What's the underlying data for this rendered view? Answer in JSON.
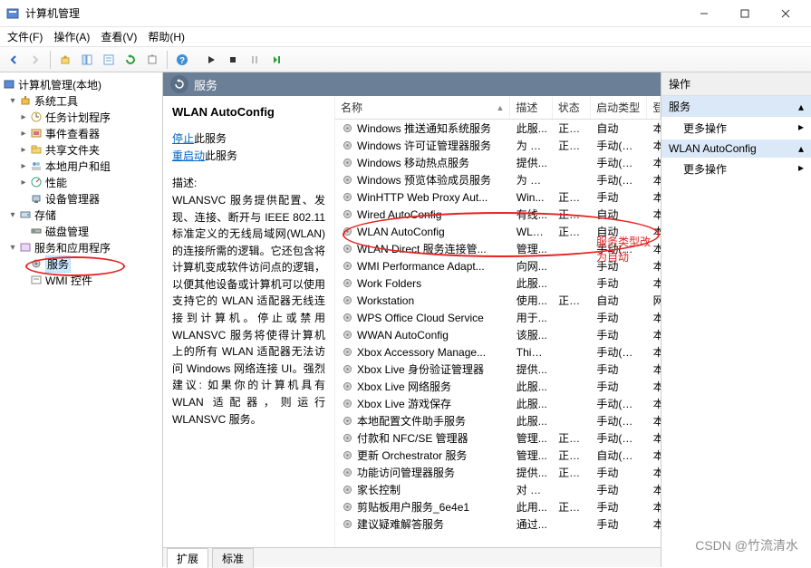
{
  "window": {
    "title": "计算机管理"
  },
  "menubar": [
    "文件(F)",
    "操作(A)",
    "查看(V)",
    "帮助(H)"
  ],
  "tree": {
    "root": "计算机管理(本地)",
    "system_tools": "系统工具",
    "task_scheduler": "任务计划程序",
    "event_viewer": "事件查看器",
    "shared_folders": "共享文件夹",
    "local_users": "本地用户和组",
    "performance": "性能",
    "device_manager": "设备管理器",
    "storage": "存储",
    "disk_management": "磁盘管理",
    "services_apps": "服务和应用程序",
    "services": "服务",
    "wmi": "WMI 控件"
  },
  "center": {
    "header": "服务",
    "selected": "WLAN AutoConfig",
    "links": {
      "stop": "停止",
      "stop_tail": "此服务",
      "restart": "重启动",
      "restart_tail": "此服务"
    },
    "desc_label": "描述:",
    "desc": "WLANSVC 服务提供配置、发现、连接、断开与 IEEE 802.11 标准定义的无线局域网(WLAN)的连接所需的逻辑。它还包含将计算机变成软件访问点的逻辑，以便其他设备或计算机可以使用支持它的 WLAN 适配器无线连接到计算机。停止或禁用 WLANSVC 服务将使得计算机上的所有 WLAN 适配器无法访问 Windows 网络连接 UI。强烈建议: 如果你的计算机具有 WLAN 适配器，则运行 WLANSVC 服务。"
  },
  "columns": {
    "name": "名称",
    "desc": "描述",
    "status": "状态",
    "startup": "启动类型",
    "logon": "登"
  },
  "services": [
    {
      "n": "Windows 推送通知系统服务",
      "d": "此服...",
      "s": "正在...",
      "t": "自动",
      "l": "本"
    },
    {
      "n": "Windows 许可证管理器服务",
      "d": "为 M...",
      "s": "正在...",
      "t": "手动(触发...",
      "l": "本"
    },
    {
      "n": "Windows 移动热点服务",
      "d": "提供...",
      "s": "",
      "t": "手动(触发...",
      "l": "本"
    },
    {
      "n": "Windows 预览体验成员服务",
      "d": "为 W...",
      "s": "",
      "t": "手动(触发...",
      "l": "本"
    },
    {
      "n": "WinHTTP Web Proxy Aut...",
      "d": "Win...",
      "s": "正在...",
      "t": "手动",
      "l": "本"
    },
    {
      "n": "Wired AutoConfig",
      "d": "有线...",
      "s": "正在...",
      "t": "自动",
      "l": "本"
    },
    {
      "n": "WLAN AutoConfig",
      "d": "WLA...",
      "s": "正在...",
      "t": "自动",
      "l": "本"
    },
    {
      "n": "WLAN Direct 服务连接管...",
      "d": "管理...",
      "s": "",
      "t": "手动(触发...",
      "l": "本"
    },
    {
      "n": "WMI Performance Adapt...",
      "d": "向网...",
      "s": "",
      "t": "手动",
      "l": "本"
    },
    {
      "n": "Work Folders",
      "d": "此服...",
      "s": "",
      "t": "手动",
      "l": "本"
    },
    {
      "n": "Workstation",
      "d": "使用...",
      "s": "正在...",
      "t": "自动",
      "l": "网"
    },
    {
      "n": "WPS Office Cloud Service",
      "d": "用于...",
      "s": "",
      "t": "手动",
      "l": "本"
    },
    {
      "n": "WWAN AutoConfig",
      "d": "该服...",
      "s": "",
      "t": "手动",
      "l": "本"
    },
    {
      "n": "Xbox Accessory Manage...",
      "d": "This ...",
      "s": "",
      "t": "手动(触发...",
      "l": "本"
    },
    {
      "n": "Xbox Live 身份验证管理器",
      "d": "提供...",
      "s": "",
      "t": "手动",
      "l": "本"
    },
    {
      "n": "Xbox Live 网络服务",
      "d": "此服...",
      "s": "",
      "t": "手动",
      "l": "本"
    },
    {
      "n": "Xbox Live 游戏保存",
      "d": "此服...",
      "s": "",
      "t": "手动(触发...",
      "l": "本"
    },
    {
      "n": "本地配置文件助手服务",
      "d": "此服...",
      "s": "",
      "t": "手动(触发...",
      "l": "本"
    },
    {
      "n": "付款和 NFC/SE 管理器",
      "d": "管理...",
      "s": "正在...",
      "t": "手动(触发...",
      "l": "本"
    },
    {
      "n": "更新 Orchestrator 服务",
      "d": "管理...",
      "s": "正在...",
      "t": "自动(延迟...",
      "l": "本"
    },
    {
      "n": "功能访问管理器服务",
      "d": "提供...",
      "s": "正在...",
      "t": "手动",
      "l": "本"
    },
    {
      "n": "家长控制",
      "d": "对 W...",
      "s": "",
      "t": "手动",
      "l": "本"
    },
    {
      "n": "剪贴板用户服务_6e4e1",
      "d": "此用...",
      "s": "正在...",
      "t": "手动",
      "l": "本"
    },
    {
      "n": "建议疑难解答服务",
      "d": "通过...",
      "s": "",
      "t": "手动",
      "l": "本"
    }
  ],
  "tabs": {
    "ext": "扩展",
    "std": "标准"
  },
  "actions": {
    "hdr": "操作",
    "sec1": "服务",
    "more1": "更多操作",
    "sec2": "WLAN AutoConfig",
    "more2": "更多操作"
  },
  "annotation": "服务类型改为自动",
  "watermark": "CSDN @竹流清水"
}
